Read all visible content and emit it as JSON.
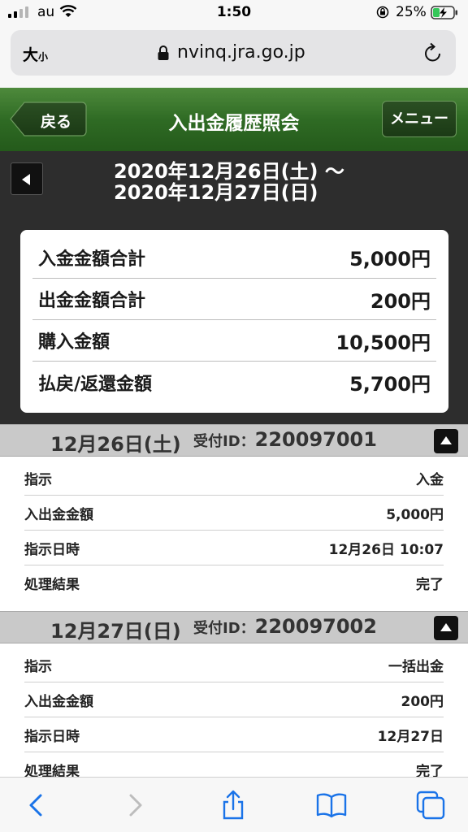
{
  "status": {
    "carrier": "au",
    "time": "1:50",
    "battery": "25%"
  },
  "urlbar": {
    "text_size_big": "大",
    "text_size_small": "小",
    "url": "nvinq.jra.go.jp"
  },
  "header": {
    "back": "戻る",
    "title": "入出金履歴照会",
    "menu": "メニュー"
  },
  "range": {
    "line1": "2020年12月26日(土) 〜",
    "line2": "2020年12月27日(日)"
  },
  "summary": [
    {
      "label": "入金金額合計",
      "value": "5,000円"
    },
    {
      "label": "出金金額合計",
      "value": "200円"
    },
    {
      "label": "購入金額",
      "value": "10,500円"
    },
    {
      "label": "払戻/返還金額",
      "value": "5,700円"
    }
  ],
  "sections": [
    {
      "date": "12月26日(土)",
      "id_label": "受付ID：",
      "id": "220097001",
      "rows": [
        {
          "label": "指示",
          "value": "入金"
        },
        {
          "label": "入出金金額",
          "value": "5,000円"
        },
        {
          "label": "指示日時",
          "value": "12月26日 10:07"
        },
        {
          "label": "処理結果",
          "value": "完了"
        }
      ]
    },
    {
      "date": "12月27日(日)",
      "id_label": "受付ID：",
      "id": "220097002",
      "rows": [
        {
          "label": "指示",
          "value": "一括出金"
        },
        {
          "label": "入出金金額",
          "value": "200円"
        },
        {
          "label": "指示日時",
          "value": "12月27日"
        },
        {
          "label": "処理結果",
          "value": "完了"
        }
      ]
    }
  ],
  "icons": [
    "back-arrow-icon",
    "forward-arrow-icon",
    "share-icon",
    "bookmarks-icon",
    "tabs-icon"
  ],
  "colors": {
    "header_green": "#2f6b24",
    "dark_band": "#2d2d2d",
    "section_gray": "#c9c9c9",
    "ios_blue": "#1a73e8"
  }
}
